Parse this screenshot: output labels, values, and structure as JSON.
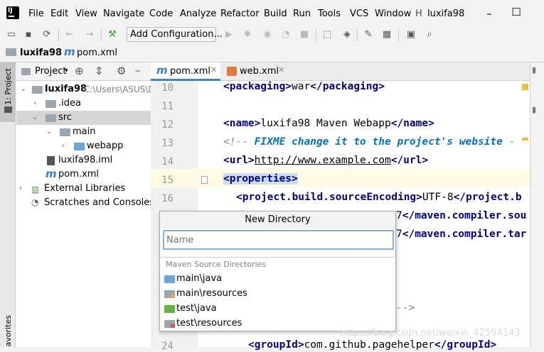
{
  "menubar": {
    "items": [
      "File",
      "Edit",
      "View",
      "Navigate",
      "Code",
      "Analyze",
      "Refactor",
      "Build",
      "Run",
      "Tools",
      "VCS",
      "Window"
    ],
    "truncated": "H",
    "project_title": "luxifa98"
  },
  "toolbar": {
    "add_configuration": "Add Configuration..."
  },
  "breadcrumb": {
    "project": "luxifa98",
    "file": "pom.xml"
  },
  "side_strip": {
    "project_tab": "1: Project",
    "favorites_tab": "avorites"
  },
  "project_panel": {
    "title": "Project",
    "tree": [
      {
        "label": "luxifa98",
        "extra": "C:\\Users\\ASUS\\D"
      },
      {
        "label": ".idea"
      },
      {
        "label": "src"
      },
      {
        "label": "main"
      },
      {
        "label": "webapp"
      },
      {
        "label": "luxifa98.iml"
      },
      {
        "label": "pom.xml"
      },
      {
        "label": "External Libraries"
      },
      {
        "label": "Scratches and Consoles"
      }
    ]
  },
  "editor": {
    "tabs": [
      "pom.xml",
      "web.xml"
    ],
    "line_numbers": [
      "10",
      "11",
      "12",
      "13",
      "14",
      "15",
      "16",
      "24"
    ],
    "lines": {
      "l10": {
        "open": "<packaging>",
        "text": "war",
        "close": "</packaging>"
      },
      "l12": {
        "open": "<name>",
        "text": "luxifa98 Maven Webapp",
        "close": "</name>"
      },
      "l13": {
        "start": "<!-- ",
        "todo": "FIXME change it to the project's website",
        "end": " -"
      },
      "l14": {
        "open": "<url>",
        "text": "http://www.example.com",
        "close": "</url>"
      },
      "l15": {
        "open": "<properties>"
      },
      "l16": {
        "open": "<project.build.sourceEncoding>",
        "text": "UTF-8",
        "close": "</project.b"
      },
      "l17": {
        "text": "7",
        "close": "</maven.compiler.sou"
      },
      "l18": {
        "text": "7",
        "close": "</maven.compiler.tar"
      },
      "l21": {
        "text": "-->"
      },
      "l24": {
        "open": "<groupId>",
        "text": "com.github.pagehelper",
        "close": "</groupId>"
      }
    }
  },
  "dialog": {
    "title": "New Directory",
    "placeholder": "Name",
    "section": "Maven Source Directories",
    "items": [
      "main\\java",
      "main\\resources",
      "test\\java",
      "test\\resources"
    ]
  },
  "watermark": "https://blog.csdn.net/weixin_42594143"
}
